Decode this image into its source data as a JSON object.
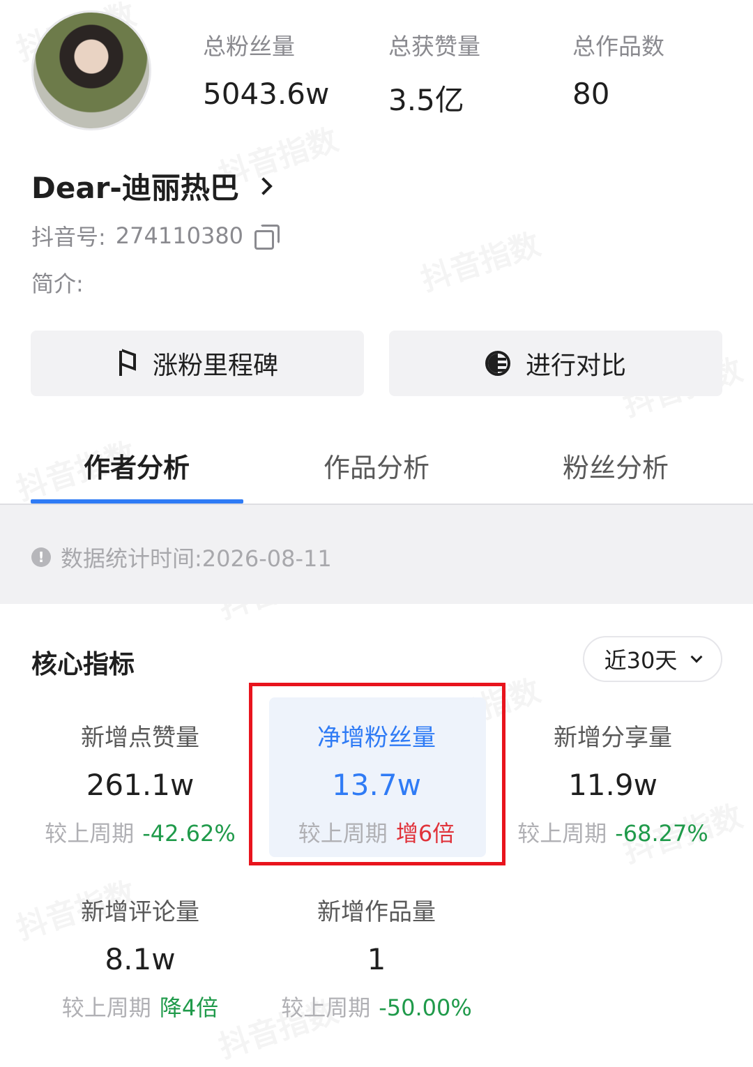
{
  "profile": {
    "stats": [
      {
        "label": "总粉丝量",
        "value": "5043.6w"
      },
      {
        "label": "总获赞量",
        "value": "3.5亿"
      },
      {
        "label": "总作品数",
        "value": "80"
      }
    ],
    "name": "Dear-迪丽热巴",
    "id_label": "抖音号:",
    "id_value": "274110380",
    "bio_label": "简介:"
  },
  "actions": {
    "milestone_label": "涨粉里程碑",
    "compare_label": "进行对比"
  },
  "tabs": [
    {
      "label": "作者分析",
      "active": true
    },
    {
      "label": "作品分析",
      "active": false
    },
    {
      "label": "粉丝分析",
      "active": false
    }
  ],
  "notice": {
    "text": "数据统计时间:2026-08-11"
  },
  "core": {
    "title": "核心指标",
    "range": "近30天",
    "compare_prefix": "较上周期",
    "metrics": [
      {
        "label": "新增点赞量",
        "value": "261.1w",
        "change": "-42.62%"
      },
      {
        "label": "净增粉丝量",
        "value": "13.7w",
        "change": "增6倍"
      },
      {
        "label": "新增分享量",
        "value": "11.9w",
        "change": "-68.27%"
      },
      {
        "label": "新增评论量",
        "value": "8.1w",
        "change": "降4倍"
      },
      {
        "label": "新增作品量",
        "value": "1",
        "change": "-50.00%"
      }
    ]
  },
  "watermark": "抖音指数",
  "colors": {
    "accent": "#2f7bf5",
    "positive_change": "#e0323a",
    "negative_change": "#1f9a4a",
    "highlight_border": "#e8141d"
  }
}
